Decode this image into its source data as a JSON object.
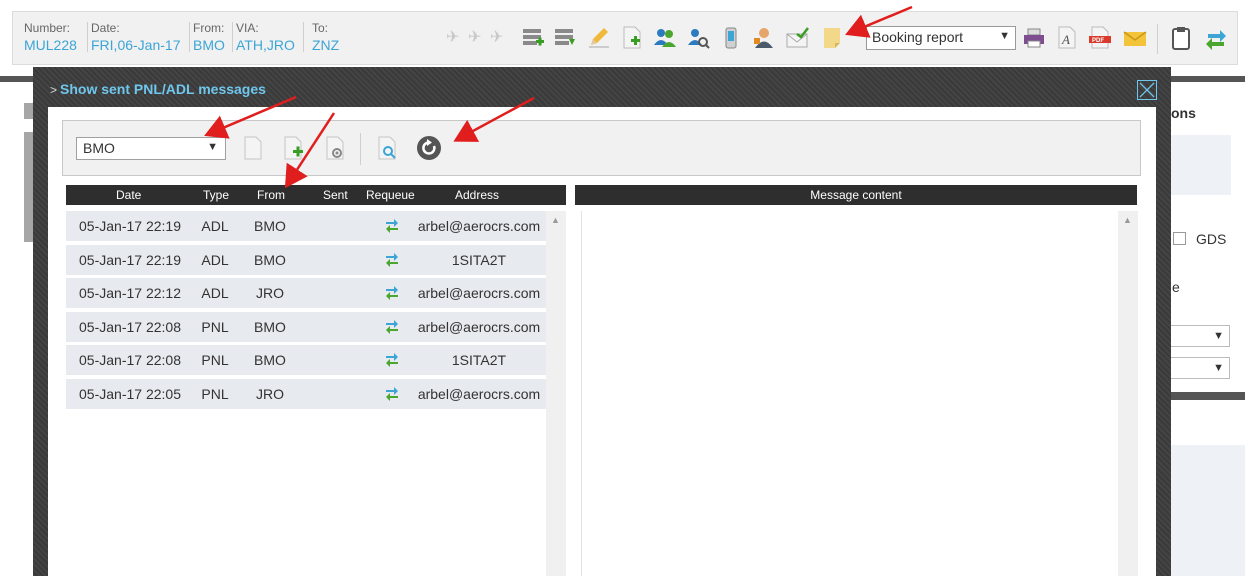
{
  "flight": {
    "number_label": "Number:",
    "number": "MUL228",
    "date_label": "Date:",
    "date": "FRI,06-Jan-17",
    "from_label": "From:",
    "from": "BMO",
    "via_label": "VIA:",
    "via": "ATH,JRO",
    "to_label": "To:",
    "to": "ZNZ"
  },
  "toolbar": {
    "report_select_value": "Booking report",
    "icons": [
      "plane-icon",
      "add-segment-icon",
      "remove-segment-icon",
      "edit-icon",
      "add-document-icon",
      "users-icon",
      "user-search-icon",
      "mobile-icon",
      "agent-icon",
      "envelope-check-icon",
      "note-icon",
      "printer-icon",
      "font-icon",
      "pdf-icon",
      "mail-icon",
      "clipboard-icon",
      "transfer-icon"
    ]
  },
  "background": {
    "text_ons": "ons",
    "text_gds": "GDS",
    "text_e": "e"
  },
  "modal": {
    "title_prefix": ">",
    "title": "Show sent PNL/ADL messages",
    "airport_select": "BMO",
    "columns": {
      "date": "Date",
      "type": "Type",
      "from": "From",
      "sent": "Sent",
      "requeue": "Requeue",
      "address": "Address"
    },
    "content_header": "Message content",
    "rows": [
      {
        "date": "05-Jan-17 22:19",
        "type": "ADL",
        "from": "BMO",
        "sent": "",
        "address": "arbel@aerocrs.com"
      },
      {
        "date": "05-Jan-17 22:19",
        "type": "ADL",
        "from": "BMO",
        "sent": "",
        "address": "1SITA2T"
      },
      {
        "date": "05-Jan-17 22:12",
        "type": "ADL",
        "from": "JRO",
        "sent": "",
        "address": "arbel@aerocrs.com"
      },
      {
        "date": "05-Jan-17 22:08",
        "type": "PNL",
        "from": "BMO",
        "sent": "",
        "address": "arbel@aerocrs.com"
      },
      {
        "date": "05-Jan-17 22:08",
        "type": "PNL",
        "from": "BMO",
        "sent": "",
        "address": "1SITA2T"
      },
      {
        "date": "05-Jan-17 22:05",
        "type": "PNL",
        "from": "JRO",
        "sent": "",
        "address": "arbel@aerocrs.com"
      }
    ]
  },
  "colors": {
    "accent": "#3ca5d6",
    "title": "#6fc7ee",
    "annotation": "#e01e1e",
    "header_bg": "#2e2e2e",
    "row_bg": "#e7eaef"
  }
}
